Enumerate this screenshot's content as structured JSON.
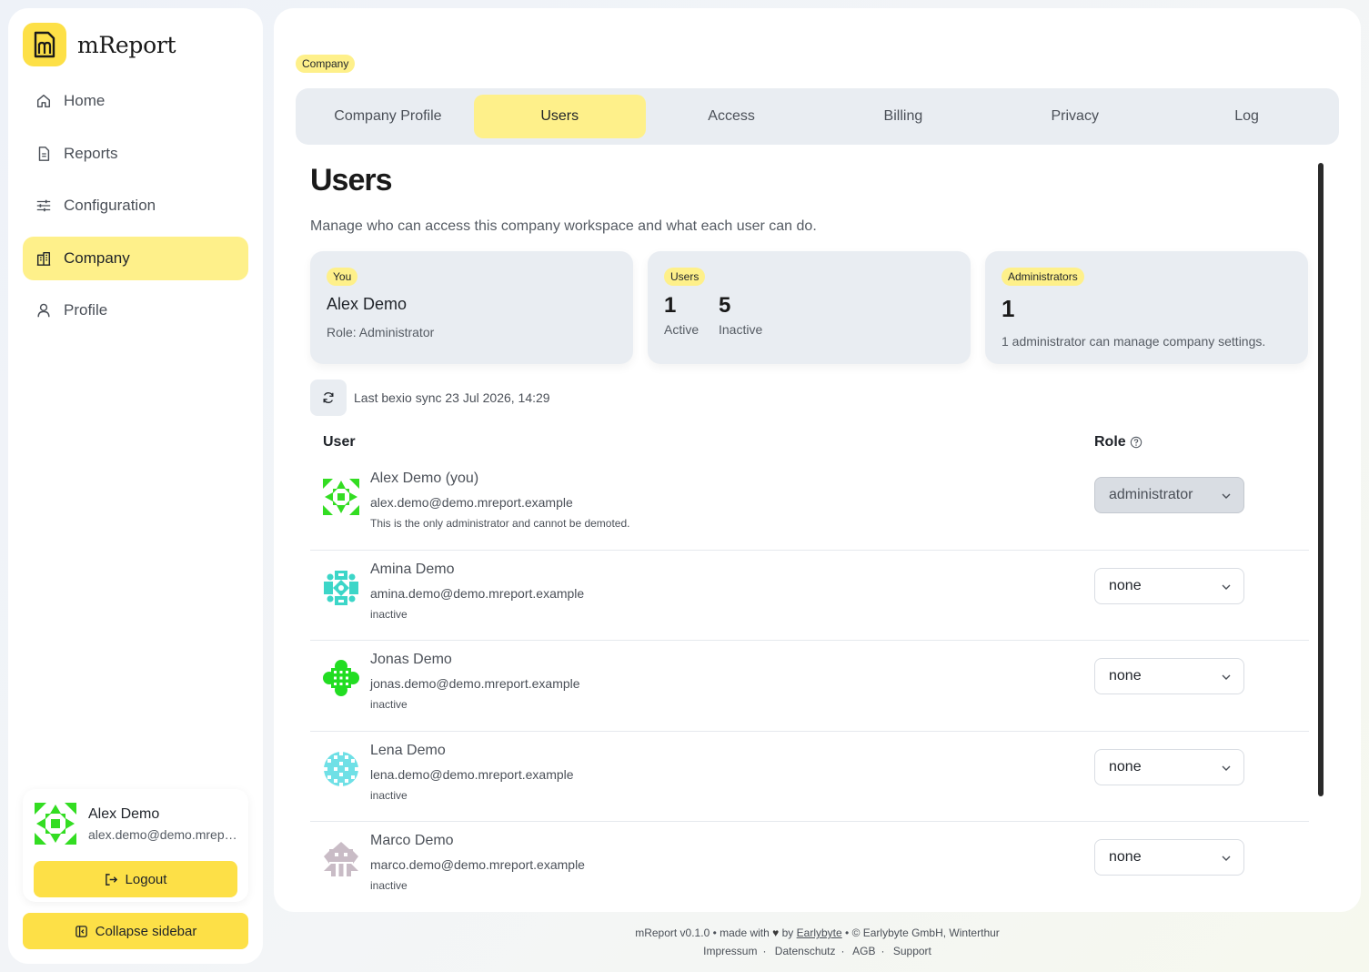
{
  "app": {
    "name": "mReport",
    "logo_letter": "m",
    "accent": "#fde047"
  },
  "sidebar": {
    "items": [
      {
        "label": "Home",
        "icon": "home-icon",
        "active": false
      },
      {
        "label": "Reports",
        "icon": "document-icon",
        "active": false
      },
      {
        "label": "Configuration",
        "icon": "sliders-icon",
        "active": false
      },
      {
        "label": "Company",
        "icon": "building-icon",
        "active": true
      },
      {
        "label": "Profile",
        "icon": "user-icon",
        "active": false
      }
    ],
    "user": {
      "name": "Alex Demo",
      "email": "alex.demo@demo.mreport.example"
    },
    "logout_label": "Logout",
    "collapse_label": "Collapse sidebar"
  },
  "breadcrumb": "Company",
  "tabs": [
    {
      "label": "Company Profile",
      "active": false
    },
    {
      "label": "Users",
      "active": true
    },
    {
      "label": "Access",
      "active": false
    },
    {
      "label": "Billing",
      "active": false
    },
    {
      "label": "Privacy",
      "active": false
    },
    {
      "label": "Log",
      "active": false
    }
  ],
  "page": {
    "title": "Users",
    "description": "Manage who can access this company workspace and what each user can do."
  },
  "stats": {
    "you": {
      "badge": "You",
      "name": "Alex Demo",
      "role": "Role: Administrator"
    },
    "users": {
      "badge": "Users",
      "active_count": "1",
      "active_label": "Active",
      "inactive_count": "5",
      "inactive_label": "Inactive"
    },
    "admins": {
      "badge": "Administrators",
      "count": "1",
      "note": "1 administrator can manage company settings."
    }
  },
  "sync": {
    "text": "Last bexio sync 23 Jul 2026, 14:29"
  },
  "table": {
    "col_user": "User",
    "col_role": "Role",
    "rows": [
      {
        "name": "Alex Demo (you)",
        "email": "alex.demo@demo.mreport.example",
        "note": "This is the only administrator and cannot be demoted.",
        "role": "administrator",
        "disabled": true,
        "avatar_color": "#33dd22"
      },
      {
        "name": "Amina Demo",
        "email": "amina.demo@demo.mreport.example",
        "note": "inactive",
        "role": "none",
        "disabled": false,
        "avatar_color": "#3cd6c8"
      },
      {
        "name": "Jonas Demo",
        "email": "jonas.demo@demo.mreport.example",
        "note": "inactive",
        "role": "none",
        "disabled": false,
        "avatar_color": "#22dd22"
      },
      {
        "name": "Lena Demo",
        "email": "lena.demo@demo.mreport.example",
        "note": "inactive",
        "role": "none",
        "disabled": false,
        "avatar_color": "#6fe0e6"
      },
      {
        "name": "Marco Demo",
        "email": "marco.demo@demo.mreport.example",
        "note": "inactive",
        "role": "none",
        "disabled": false,
        "avatar_color": "#c9bcc6"
      }
    ]
  },
  "footer": {
    "line1_a": "mReport v0.1.0 • made with",
    "line1_by": "by",
    "line1_link": "Earlybyte",
    "line1_b": "• © Earlybyte GmbH, Winterthur",
    "links": [
      "Impressum",
      "Datenschutz",
      "AGB",
      "Support"
    ]
  }
}
